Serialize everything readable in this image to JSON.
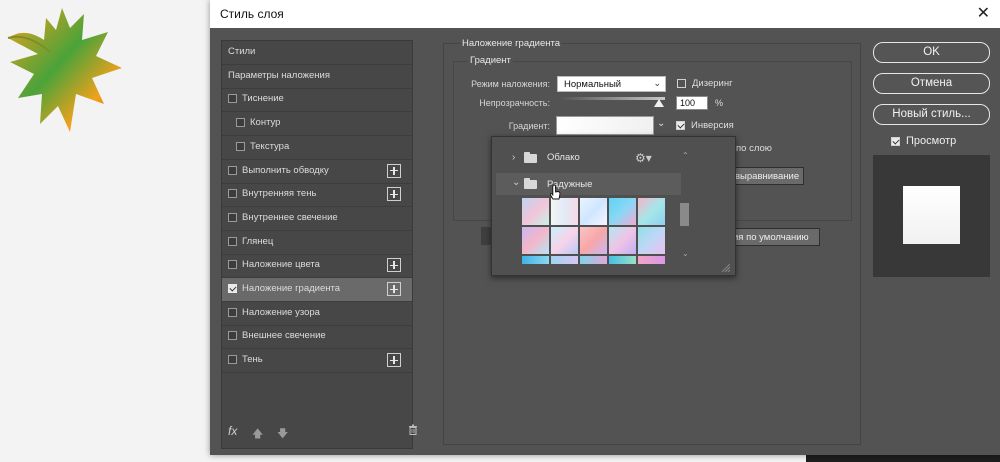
{
  "dialog": {
    "title": "Стиль слоя",
    "close_icon": "close-icon"
  },
  "styles_panel": {
    "items": [
      {
        "label": "Стили",
        "checkbox": false,
        "checked": false,
        "plus": false,
        "indent": 0
      },
      {
        "label": "Параметры наложения",
        "checkbox": false,
        "checked": false,
        "plus": false,
        "indent": 0
      },
      {
        "label": "Тиснение",
        "checkbox": true,
        "checked": false,
        "plus": false,
        "indent": 0
      },
      {
        "label": "Контур",
        "checkbox": true,
        "checked": false,
        "plus": false,
        "indent": 1
      },
      {
        "label": "Текстура",
        "checkbox": true,
        "checked": false,
        "plus": false,
        "indent": 1
      },
      {
        "label": "Выполнить обводку",
        "checkbox": true,
        "checked": false,
        "plus": true,
        "indent": 0
      },
      {
        "label": "Внутренняя тень",
        "checkbox": true,
        "checked": false,
        "plus": true,
        "indent": 0
      },
      {
        "label": "Внутреннее свечение",
        "checkbox": true,
        "checked": false,
        "plus": false,
        "indent": 0
      },
      {
        "label": "Глянец",
        "checkbox": true,
        "checked": false,
        "plus": false,
        "indent": 0
      },
      {
        "label": "Наложение цвета",
        "checkbox": true,
        "checked": false,
        "plus": true,
        "indent": 0
      },
      {
        "label": "Наложение градиента",
        "checkbox": true,
        "checked": true,
        "plus": true,
        "indent": 0,
        "selected": true
      },
      {
        "label": "Наложение узора",
        "checkbox": true,
        "checked": false,
        "plus": false,
        "indent": 0
      },
      {
        "label": "Внешнее свечение",
        "checkbox": true,
        "checked": false,
        "plus": false,
        "indent": 0
      },
      {
        "label": "Тень",
        "checkbox": true,
        "checked": false,
        "plus": true,
        "indent": 0
      }
    ],
    "footer": {
      "fx": "fx",
      "up_icon": "arrow-up-icon",
      "down_icon": "arrow-down-icon",
      "trash_icon": "trash-icon"
    }
  },
  "gradient_overlay": {
    "group_title": "Наложение градиента",
    "inner_title": "Градиент",
    "blend_mode_label": "Режим наложения:",
    "blend_mode_value": "Нормальный",
    "dither_label": "Дизеринг",
    "dither_checked": false,
    "opacity_label": "Непрозрачность:",
    "opacity_value": "100",
    "opacity_unit": "%",
    "opacity_level": 1.0,
    "gradient_label": "Градиент:",
    "reverse_label": "Инверсия",
    "reverse_checked": true,
    "align_partial": "по слою",
    "reset_align_partial": "выравнивание",
    "default_partial": "ия по умолчанию"
  },
  "gradient_picker": {
    "folders": [
      {
        "label": "Облако",
        "expanded": false
      },
      {
        "label": "Радужные",
        "expanded": true
      }
    ],
    "gear_icon": "gear-icon"
  },
  "actions": {
    "ok": "OK",
    "cancel": "Отмена",
    "new_style": "Новый стиль...",
    "preview_label": "Просмотр",
    "preview_checked": true
  },
  "colors": {
    "dialog_bg": "#535353",
    "panel_bg": "#474747",
    "selected_row": "#6a6a6a",
    "preview_bg": "#383838"
  }
}
